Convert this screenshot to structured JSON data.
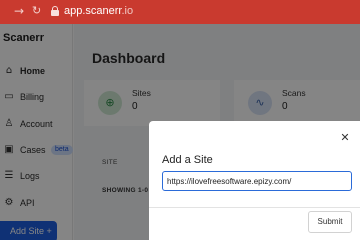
{
  "browser": {
    "url_host": "app.scanerr",
    "url_tld": ".io",
    "forward_icon": "arrow-right-icon",
    "reload_icon": "reload-icon",
    "lock_icon": "lock-icon",
    "bar_color": "#c93a2f"
  },
  "sidebar": {
    "brand": "Scanerr",
    "items": [
      {
        "label": "Home",
        "icon": "home-icon",
        "active": true
      },
      {
        "label": "Billing",
        "icon": "credit-card-icon"
      },
      {
        "label": "Account",
        "icon": "user-icon"
      },
      {
        "label": "Cases",
        "icon": "briefcase-icon",
        "badge": "beta"
      },
      {
        "label": "Logs",
        "icon": "list-icon"
      },
      {
        "label": "API",
        "icon": "api-icon"
      }
    ],
    "add_site": "Add Site +"
  },
  "main": {
    "title": "Dashboard",
    "stats": [
      {
        "label": "Sites",
        "value": "0",
        "icon": "globe-icon"
      },
      {
        "label": "Scans",
        "value": "0",
        "icon": "activity-icon"
      }
    ],
    "table_header": "SITE",
    "table_status": "SHOWING 1-0"
  },
  "modal": {
    "title": "Add a Site",
    "input_value": "https://ilovefreesoftware.epizy.com/",
    "submit_label": "Submit",
    "close_icon": "close-icon",
    "accent": "#1e5fe0"
  }
}
